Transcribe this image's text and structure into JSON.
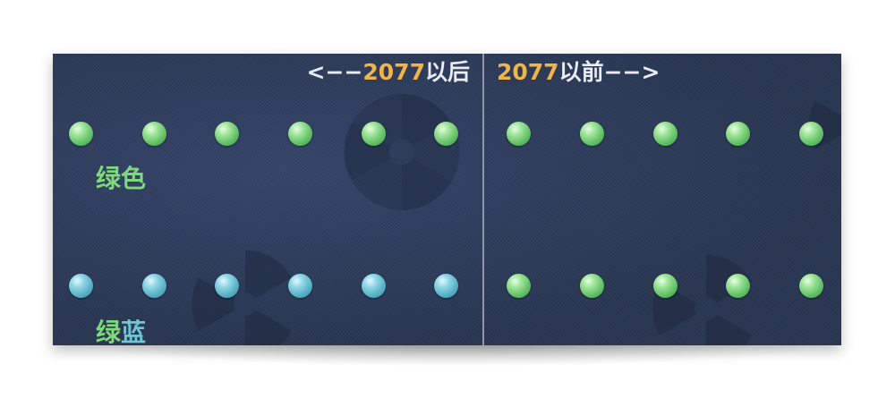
{
  "header": {
    "left": {
      "arrow": "<−−",
      "year": "2077",
      "suffix": "以后"
    },
    "right": {
      "year": "2077",
      "suffix": "以前",
      "arrow": "−−>"
    }
  },
  "labels": {
    "green": "绿色",
    "green_blue_part1": "绿",
    "green_blue_part2": "蓝"
  },
  "colors": {
    "board": "#2c3a55",
    "highlight": "#f0b54a",
    "green": "#7fd97c",
    "blue": "#6fc4d6",
    "divider": "#8e96a8"
  },
  "beads": {
    "left_top": [
      "green",
      "green",
      "green",
      "green",
      "green",
      "green"
    ],
    "left_bottom": [
      "blue",
      "blue",
      "blue",
      "blue",
      "blue",
      "blue"
    ],
    "right_top": [
      "green",
      "green",
      "green",
      "green",
      "green"
    ],
    "right_bottom": [
      "green",
      "green",
      "green",
      "green",
      "green"
    ]
  }
}
